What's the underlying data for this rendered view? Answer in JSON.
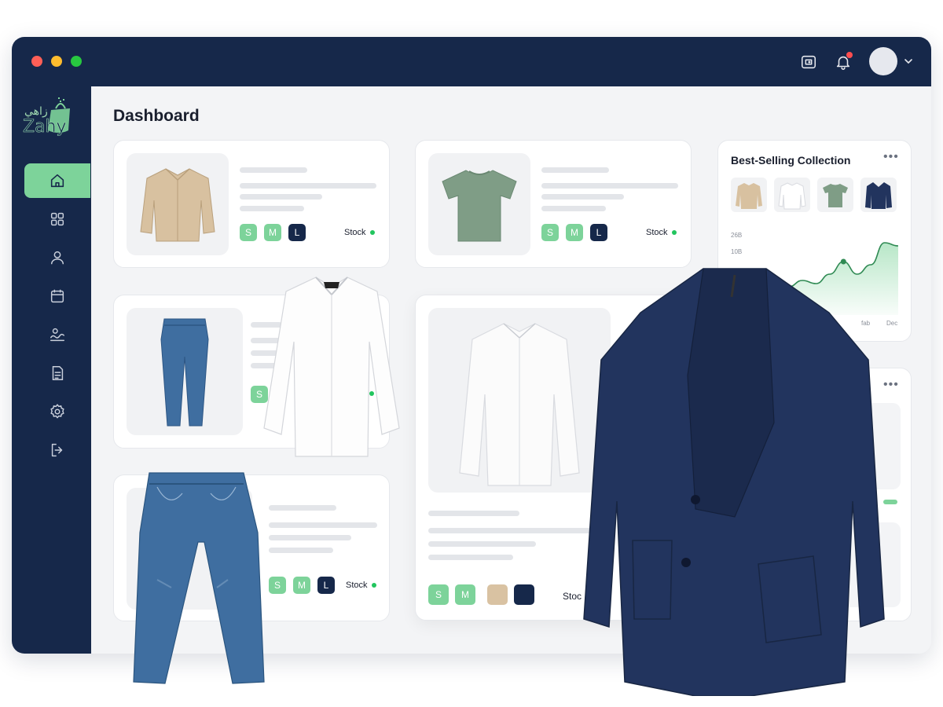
{
  "window": {
    "title": ""
  },
  "header": {
    "notification_badge": true
  },
  "brand": {
    "logo_text_arabic": "زاهي",
    "logo_text_latin": "Zahy"
  },
  "sidebar": {
    "items": [
      {
        "name": "home",
        "icon": "home-icon",
        "active": true
      },
      {
        "name": "grid",
        "icon": "grid-icon",
        "active": false
      },
      {
        "name": "users",
        "icon": "user-icon",
        "active": false
      },
      {
        "name": "calendar",
        "icon": "calendar-icon",
        "active": false
      },
      {
        "name": "analytics",
        "icon": "analytics-icon",
        "active": false
      },
      {
        "name": "documents",
        "icon": "document-icon",
        "active": false
      },
      {
        "name": "settings",
        "icon": "gear-icon",
        "active": false
      },
      {
        "name": "logout",
        "icon": "logout-icon",
        "active": false
      }
    ]
  },
  "main": {
    "page_title": "Dashboard"
  },
  "products": [
    {
      "item": "beige-shirt",
      "sizes": [
        "S",
        "M",
        "L"
      ],
      "stock_label": "Stock",
      "in_stock": true
    },
    {
      "item": "green-tshirt",
      "sizes": [
        "S",
        "M",
        "L"
      ],
      "stock_label": "Stock",
      "in_stock": true
    },
    {
      "item": "jeans",
      "sizes": [
        "S"
      ],
      "stock_label": "",
      "in_stock": true
    },
    {
      "item": "jeans",
      "sizes": [
        "S",
        "M",
        "L"
      ],
      "stock_label": "Stock",
      "in_stock": true
    },
    {
      "item": "white-shirt",
      "sizes": [
        "S",
        "M"
      ],
      "stock_label": "Stoc",
      "in_stock": true
    }
  ],
  "best_selling": {
    "title": "Best-Selling Collection",
    "items": [
      "beige-shirt",
      "white-shirt",
      "green-tshirt",
      "navy-blazer"
    ],
    "chart_data": {
      "type": "area",
      "y_tick_labels": [
        "26B",
        "10B"
      ],
      "x_tick_labels": [
        "fab",
        "Dec"
      ],
      "values": [
        6,
        5,
        7,
        5,
        8,
        10,
        9,
        12,
        16,
        12,
        15,
        22,
        21
      ],
      "ylim": [
        0,
        26
      ],
      "color": "#7dd39a"
    }
  },
  "colors": {
    "navy": "#16284a",
    "accent": "#7dd39a",
    "bg": "#f3f4f6",
    "stock_dot": "#22c55e"
  }
}
